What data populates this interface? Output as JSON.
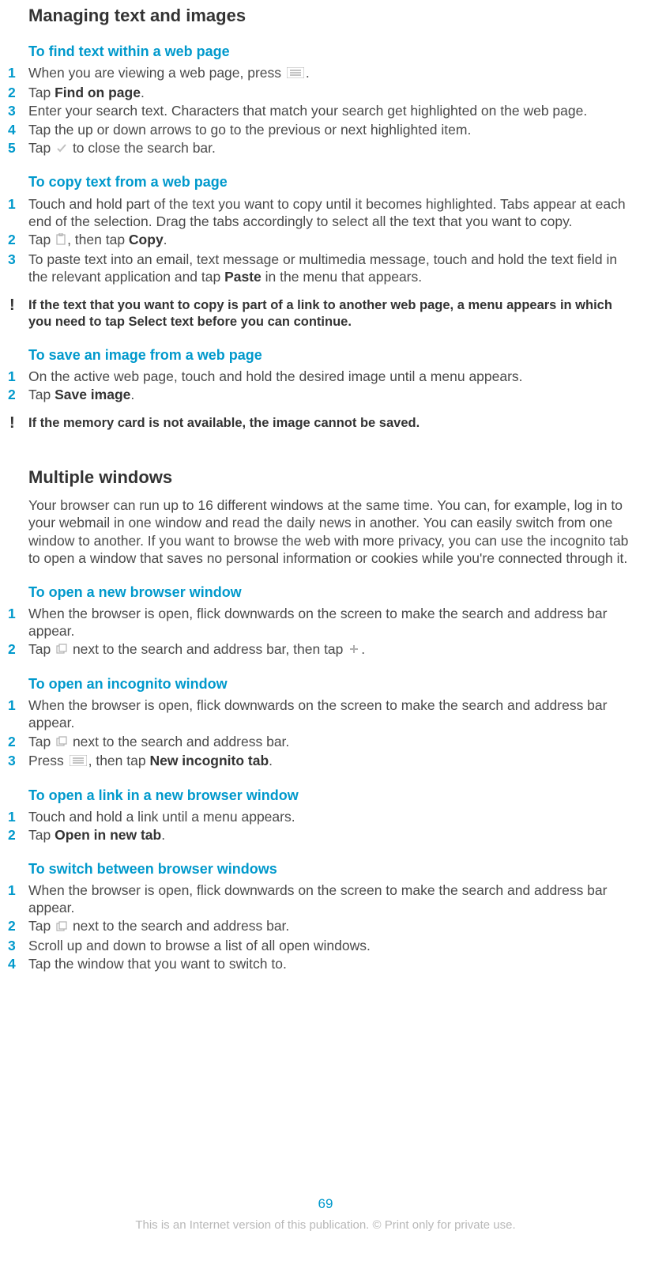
{
  "heading1": "Managing text and images",
  "sub1": "To find text within a web page",
  "s1": {
    "1a": "When you are viewing a web page, press ",
    "1b": ".",
    "2a": "Tap ",
    "2b": "Find on page",
    "2c": ".",
    "3": "Enter your search text. Characters that match your search get highlighted on the web page.",
    "4": "Tap the up or down arrows to go to the previous or next highlighted item.",
    "5a": "Tap ",
    "5b": " to close the search bar."
  },
  "sub2": "To copy text from a web page",
  "s2": {
    "1": "Touch and hold part of the text you want to copy until it becomes highlighted. Tabs appear at each end of the selection. Drag the tabs accordingly to select all the text that you want to copy.",
    "2a": "Tap ",
    "2b": ", then tap ",
    "2c": "Copy",
    "2d": ".",
    "3a": "To paste text into an email, text message or multimedia message, touch and hold the text field in the relevant application and tap ",
    "3b": "Paste",
    "3c": " in the menu that appears."
  },
  "note1a": "If the text that you want to copy is part of a link to another web page, a menu appears in which you need to tap ",
  "note1b": "Select text",
  "note1c": " before you can continue.",
  "sub3": "To save an image from a web page",
  "s3": {
    "1": "On the active web page, touch and hold the desired image until a menu appears.",
    "2a": "Tap ",
    "2b": "Save image",
    "2c": "."
  },
  "note2": "If the memory card is not available, the image cannot be saved.",
  "heading2": "Multiple windows",
  "para2": "Your browser can run up to 16 different windows at the same time. You can, for example, log in to your webmail in one window and read the daily news in another. You can easily switch from one window to another. If you want to browse the web with more privacy, you can use the incognito tab to open a window that saves no personal information or cookies while you're connected through it.",
  "sub4": "To open a new browser window",
  "s4": {
    "1": "When the browser is open, flick downwards on the screen to make the search and address bar appear.",
    "2a": "Tap ",
    "2b": " next to the search and address bar, then tap ",
    "2c": "."
  },
  "sub5": "To open an incognito window",
  "s5": {
    "1": "When the browser is open, flick downwards on the screen to make the search and address bar appear.",
    "2a": "Tap ",
    "2b": " next to the search and address bar.",
    "3a": "Press ",
    "3b": ", then tap ",
    "3c": "New incognito tab",
    "3d": "."
  },
  "sub6": "To open a link in a new browser window",
  "s6": {
    "1": "Touch and hold a link until a menu appears.",
    "2a": "Tap ",
    "2b": "Open in new tab",
    "2c": "."
  },
  "sub7": "To switch between browser windows",
  "s7": {
    "1": "When the browser is open, flick downwards on the screen to make the search and address bar appear.",
    "2a": "Tap ",
    "2b": " next to the search and address bar.",
    "3": "Scroll up and down to browse a list of all open windows.",
    "4": "Tap the window that you want to switch to."
  },
  "page_num": "69",
  "footer": "This is an Internet version of this publication. © Print only for private use.",
  "nums": {
    "1": "1",
    "2": "2",
    "3": "3",
    "4": "4",
    "5": "5"
  }
}
